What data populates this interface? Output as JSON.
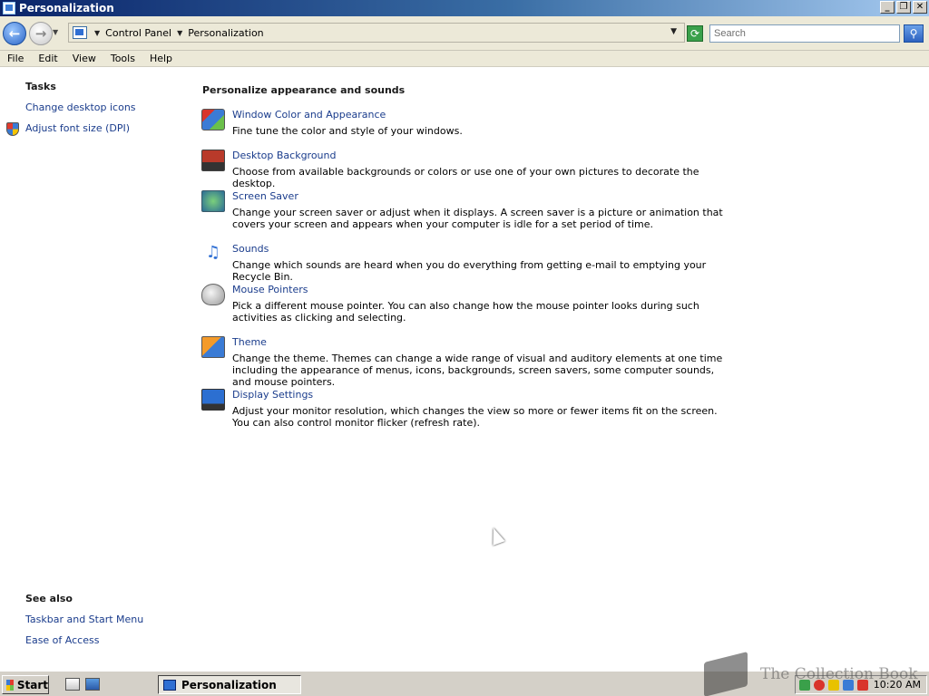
{
  "window": {
    "title": "Personalization",
    "min": "_",
    "max": "❐",
    "close": "✕"
  },
  "addressbar": {
    "crumbs": [
      "Control Panel",
      "Personalization"
    ],
    "search_placeholder": "Search"
  },
  "menu": [
    "File",
    "Edit",
    "View",
    "Tools",
    "Help"
  ],
  "left_pane": {
    "tasks_heading": "Tasks",
    "tasks": [
      "Change desktop icons",
      "Adjust font size (DPI)"
    ],
    "see_also_heading": "See also",
    "see_also": [
      "Taskbar and Start Menu",
      "Ease of Access"
    ]
  },
  "main": {
    "heading": "Personalize appearance and sounds",
    "items": [
      {
        "icon": "window-color-icon",
        "title": "Window Color and Appearance",
        "desc": "Fine tune the color and style of your windows."
      },
      {
        "icon": "desktop-background-icon",
        "title": "Desktop Background",
        "desc": "Choose from available backgrounds or colors or use one of your own pictures to decorate the desktop."
      },
      {
        "icon": "screen-saver-icon",
        "title": "Screen Saver",
        "desc": "Change your screen saver or adjust when it displays. A screen saver is a picture or animation that covers your screen and appears when your computer is idle for a set period of time."
      },
      {
        "icon": "sounds-icon",
        "title": "Sounds",
        "desc": "Change which sounds are heard when you do everything from getting e-mail to emptying your Recycle Bin."
      },
      {
        "icon": "mouse-pointers-icon",
        "title": "Mouse Pointers",
        "desc": "Pick a different mouse pointer. You can also change how the mouse pointer looks during such activities as clicking and selecting."
      },
      {
        "icon": "theme-icon",
        "title": "Theme",
        "desc": "Change the theme. Themes can change a wide range of visual and auditory elements at one time including the appearance of menus, icons, backgrounds, screen savers, some computer sounds, and mouse pointers."
      },
      {
        "icon": "display-settings-icon",
        "title": "Display Settings",
        "desc": "Adjust your monitor resolution, which changes the view so more or fewer items fit on the screen. You can also control monitor flicker (refresh rate)."
      }
    ]
  },
  "taskbar": {
    "start_label": "Start",
    "task_label": "Personalization",
    "clock": "10:20 AM"
  },
  "watermark": {
    "text": "The Collection Book"
  }
}
